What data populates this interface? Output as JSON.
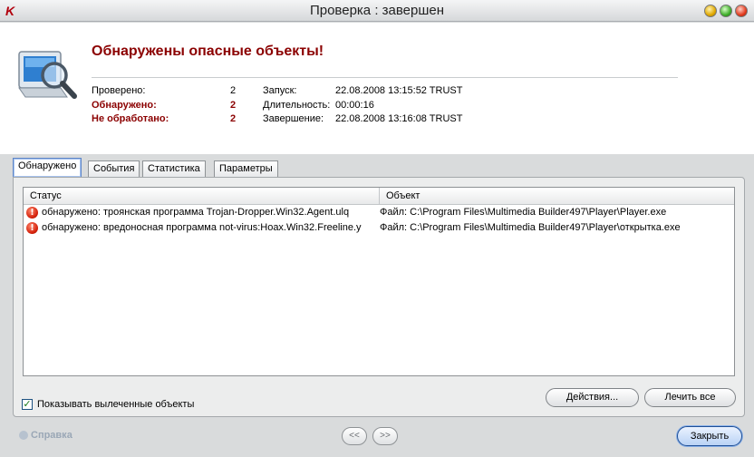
{
  "window": {
    "title": "Проверка : завершен"
  },
  "header": {
    "headline": "Обнаружены опасные объекты!",
    "stats": [
      {
        "label": "Проверено:",
        "value": "2",
        "label2": "Запуск:",
        "value2": "22.08.2008 13:15:52 TRUST",
        "severity": "normal"
      },
      {
        "label": "Обнаружено:",
        "value": "2",
        "label2": "Длительность:",
        "value2": "00:00:16",
        "severity": "danger"
      },
      {
        "label": "Не обработано:",
        "value": "2",
        "label2": "Завершение:",
        "value2": "22.08.2008 13:16:08 TRUST",
        "severity": "danger"
      }
    ]
  },
  "tabs": [
    {
      "label": "Обнаружено",
      "active": true
    },
    {
      "label": "События",
      "active": false
    },
    {
      "label": "Статистика",
      "active": false
    },
    {
      "label": "Параметры",
      "active": false
    }
  ],
  "list": {
    "columns": {
      "status": "Статус",
      "object": "Объект"
    },
    "rows": [
      {
        "icon": "warning-icon",
        "status": "обнаружено: троянская программа Trojan-Dropper.Win32.Agent.ulq",
        "object": "Файл: C:\\Program Files\\Multimedia Builder497\\Player\\Player.exe"
      },
      {
        "icon": "warning-icon",
        "status": "обнаружено: вредоносная программа not-virus:Hoax.Win32.Freeline.y",
        "object": "Файл: C:\\Program Files\\Multimedia Builder497\\Player\\открытка.exe"
      }
    ]
  },
  "options": {
    "show_cured_label": "Показывать вылеченные объекты",
    "show_cured_checked": true
  },
  "buttons": {
    "actions": "Действия...",
    "cure_all": "Лечить все",
    "prev": "<<",
    "next": ">>",
    "close": "Закрыть"
  },
  "footer": {
    "help": "Справка"
  },
  "colors": {
    "danger": "#8b0000",
    "accent": "#5f86c6"
  }
}
